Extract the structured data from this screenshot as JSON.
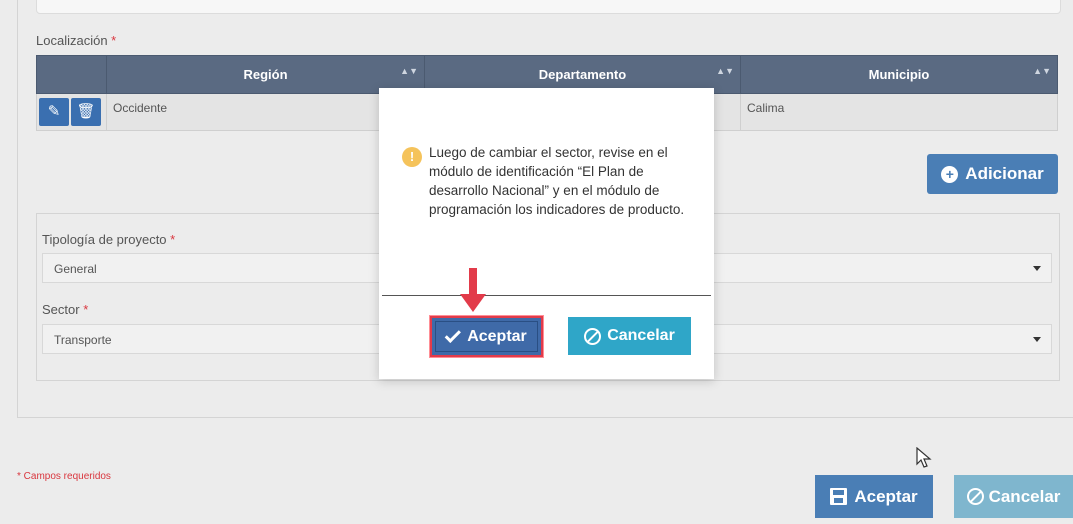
{
  "localizacion": {
    "label": "Localización",
    "required_mark": "*",
    "columns": [
      "Región",
      "Departamento",
      "Municipio"
    ],
    "rows": [
      {
        "region": "Occidente",
        "departamento": "",
        "municipio": "Calima"
      }
    ],
    "add_label": "Adicionar"
  },
  "form": {
    "tipologia_label": "Tipología de proyecto",
    "tipologia_value": "General",
    "sector_label": "Sector",
    "sector_value": "Transporte"
  },
  "footer": {
    "required_note": "* Campos requeridos",
    "accept_label": "Aceptar",
    "cancel_label": "Cancelar"
  },
  "modal": {
    "message": "Luego de cambiar el sector, revise en el módulo de identificación “El Plan de desarrollo Nacional” y en el módulo de programación los indicadores de producto.",
    "icon": "!",
    "accept_label": "Aceptar",
    "cancel_label": "Cancelar"
  },
  "colors": {
    "primary": "#4a7eb5",
    "header": "#5a6a82",
    "info": "#2fa6c8",
    "warning": "#f5c35b",
    "highlight": "#e23b4a"
  }
}
